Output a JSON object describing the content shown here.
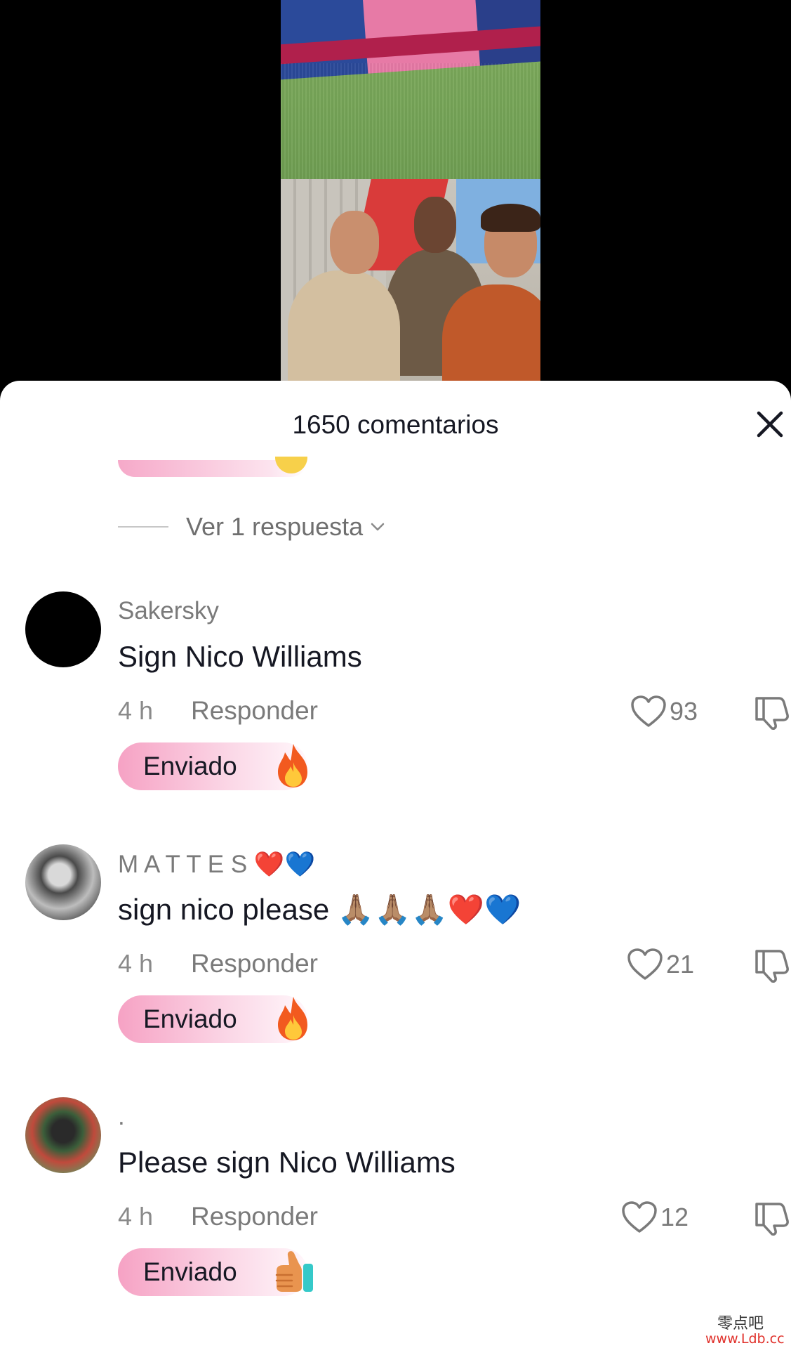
{
  "sheet": {
    "title": "1650 comentarios"
  },
  "replies_toggle": {
    "label": "Ver 1 respuesta"
  },
  "comments": [
    {
      "username": "Sakersky",
      "text": "Sign Nico Williams",
      "time": "4 h",
      "reply_label": "Responder",
      "likes": "93",
      "chip_label": "Enviado",
      "chip_emoji": "fire-icon"
    },
    {
      "username": "M A T T E S ❤️💙",
      "text": "sign nico please 🙏🏽🙏🏽🙏🏽❤️💙",
      "time": "4 h",
      "reply_label": "Responder",
      "likes": "21",
      "chip_label": "Enviado",
      "chip_emoji": "fire-icon"
    },
    {
      "username": ".",
      "text": "Please sign Nico Williams",
      "time": "4 h",
      "reply_label": "Responder",
      "likes": "12",
      "chip_label": "Enviado",
      "chip_emoji": "thumbs-up-icon"
    }
  ],
  "watermark": {
    "cn": "零点吧",
    "url": "www.Ldb.cc"
  },
  "colors": {
    "chip_pink": "#f6a2c4",
    "text_primary": "#161823",
    "text_secondary": "#7a7a7a"
  }
}
